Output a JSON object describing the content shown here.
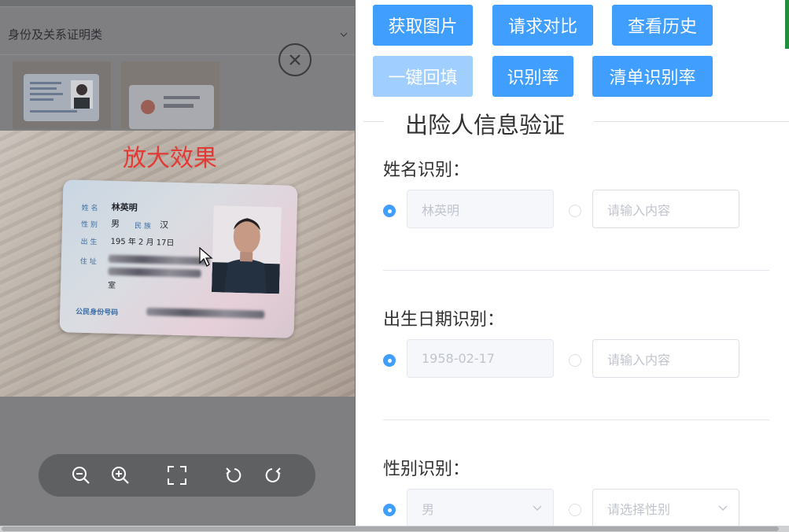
{
  "viewer": {
    "category_label": "身份及关系证明类",
    "zoom_title": "放大效果",
    "card": {
      "name_label": "姓 名",
      "name_value": "林英明",
      "gender_label": "性 别",
      "gender_value": "男",
      "ethnicity_label": "民 族",
      "ethnicity_value": "汉",
      "birth_label": "出 生",
      "birth_value": "195  年  2 月 17日",
      "address_label": "住 址",
      "address_tail": "室",
      "id_label": "公民身份号码"
    },
    "tools": [
      "zoom-out",
      "zoom-in",
      "fullscreen",
      "rotate-left",
      "rotate-right"
    ]
  },
  "actions": {
    "row1": [
      "获取图片",
      "请求对比",
      "查看历史"
    ],
    "row2": [
      "一键回填",
      "识别率",
      "清单识别率"
    ]
  },
  "section_title": "出险人信息验证",
  "fields": [
    {
      "label": "姓名识别：",
      "recognized": "林英明",
      "manual_placeholder": "请输入内容",
      "selected": "recognized"
    },
    {
      "label": "出生日期识别：",
      "recognized": "1958-02-17",
      "manual_placeholder": "请输入内容",
      "selected": "recognized"
    },
    {
      "label": "性别识别：",
      "recognized": "男",
      "manual_placeholder": "请选择性别",
      "selected": "recognized"
    }
  ],
  "colors": {
    "primary": "#409eff",
    "primary_disabled": "#a0cfff",
    "zoom_title": "#e23a35"
  }
}
